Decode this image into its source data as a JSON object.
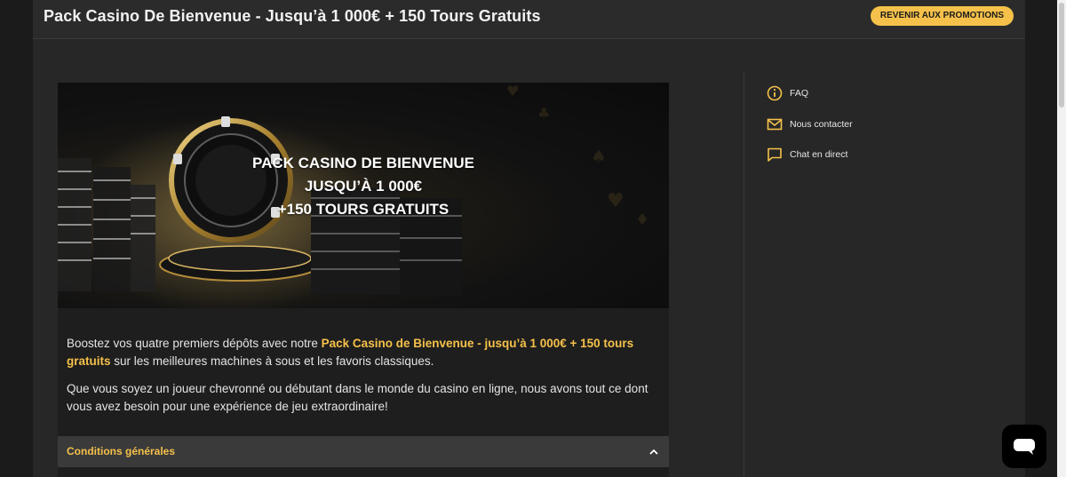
{
  "header": {
    "title": "Pack Casino De Bienvenue - Jusqu’à 1 000€ + 150 Tours Gratuits",
    "back_button": "REVENIR AUX PROMOTIONS"
  },
  "banner": {
    "line1": "PACK CASINO DE BIENVENUE",
    "line2": "JUSQU’À 1 000€",
    "line3": "+150 TOURS GRATUITS"
  },
  "body": {
    "p1_start": "Boostez vos quatre premiers dépôts avec notre ",
    "p1_highlight": "Pack Casino de Bienvenue - jusqu’à 1 000€ + 150 tours gratuits",
    "p1_end": " sur les meilleures machines à sous et les favoris classiques.",
    "p2": "Que vous soyez un joueur chevronné ou débutant dans le monde du casino en ligne, nous avons tout ce dont vous avez besoin pour une expérience de jeu extraordinaire!"
  },
  "accordion": {
    "title": "Conditions générales"
  },
  "sidebar": {
    "items": [
      {
        "label": "FAQ",
        "icon": "info-icon"
      },
      {
        "label": "Nous contacter",
        "icon": "mail-icon"
      },
      {
        "label": "Chat en direct",
        "icon": "chat-icon"
      }
    ]
  },
  "colors": {
    "accent": "#f5c14a",
    "background": "#272727",
    "header": "#2b2b2b"
  }
}
